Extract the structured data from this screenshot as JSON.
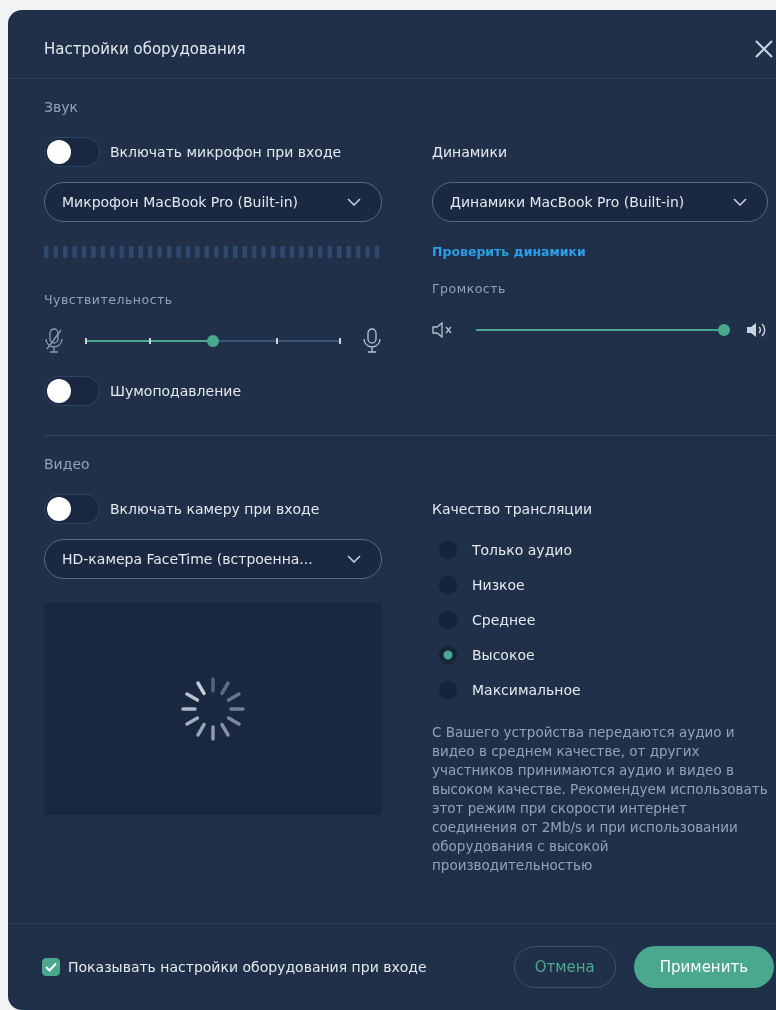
{
  "window": {
    "title": "Настройки оборудования"
  },
  "sound": {
    "heading": "Звук",
    "mic_toggle": {
      "label": "Включать микрофон при входе",
      "on": false
    },
    "mic_select": {
      "value": "Микрофон MacBook Pro (Built-in)"
    },
    "speakers_label": "Динамики",
    "speaker_select": {
      "value": "Динамики MacBook Pro (Built-in)"
    },
    "test_link": "Проверить динамики",
    "sensitivity": {
      "label": "Чувствительность",
      "level": 0.5
    },
    "volume": {
      "label": "Громкость",
      "level": 1
    },
    "noise_toggle": {
      "label": "Шумоподавление",
      "on": false
    }
  },
  "video": {
    "heading": "Видео",
    "camera_toggle": {
      "label": "Включать камеру при входе",
      "on": false
    },
    "camera_select": {
      "value": "HD-камера FaceTime (встроенна..."
    },
    "quality_label": "Качество трансляции",
    "quality_options": [
      {
        "label": "Только аудио",
        "selected": false
      },
      {
        "label": "Низкое",
        "selected": false
      },
      {
        "label": "Среднее",
        "selected": false
      },
      {
        "label": "Высокое",
        "selected": true
      },
      {
        "label": "Максимальное",
        "selected": false
      }
    ],
    "description": "С Вашего устройства передаются аудио и видео в среднем качестве, от других участников принимаются аудио и видео в высоком качестве. Рекомендуем использовать этот режим при скорости интернет соединения от 2Mb/s и при использовании оборудования с высокой производительностью"
  },
  "footer": {
    "show_on_entry": {
      "label": "Показывать настройки оборудования при входе",
      "checked": true
    },
    "buttons": [
      {
        "label": "Отмена",
        "kind": "secondary"
      },
      {
        "label": "Применить",
        "kind": "primary"
      }
    ]
  }
}
